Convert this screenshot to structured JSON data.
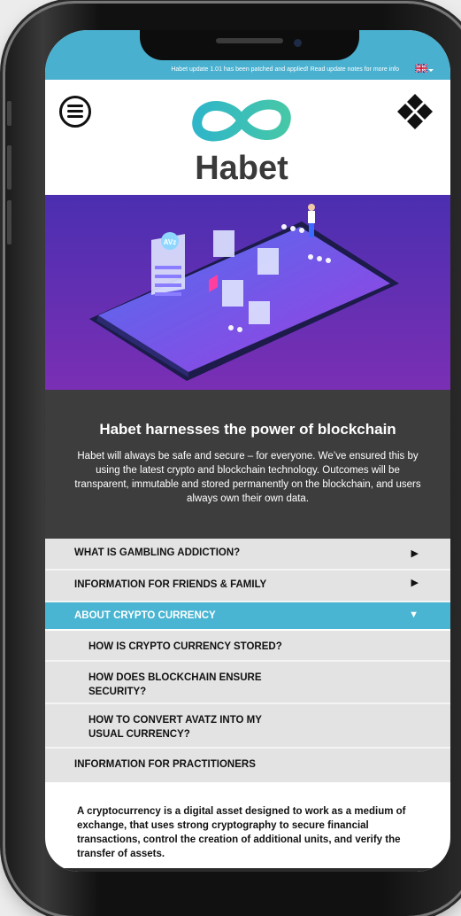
{
  "banner": {
    "update_text": "Habet update 1.01 has been patched and applied! Read update notes for more info",
    "language_flag": "uk-flag-icon"
  },
  "header": {
    "logo_text": "Habet",
    "menu_icon": "hamburger-menu-icon",
    "grid_icon": "diamond-grid-icon"
  },
  "hero": {
    "coin_label": "AVz"
  },
  "info": {
    "title": "Habet harnesses the power of blockchain",
    "body": "Habet will always be safe and secure – for everyone. We’ve ensured this by using the latest crypto and blockchain technology. Outcomes will be transparent, immutable and stored permanently on the blockchain, and users always own their own data."
  },
  "accordion": [
    {
      "label": "WHAT IS GAMBLING ADDICTION?",
      "arrow": "▶",
      "state": "collapsed"
    },
    {
      "label": "INFORMATION FOR FRIENDS & FAMILY",
      "arrow": "▶",
      "state": "collapsed"
    },
    {
      "label": "ABOUT CRYPTO CURRENCY",
      "arrow": "▼",
      "state": "expanded"
    }
  ],
  "sub_items": [
    {
      "label": "HOW IS CRYPTO CURRENCY STORED?"
    },
    {
      "label": "HOW DOES BLOCKCHAIN ENSURE SECURITY?"
    },
    {
      "label": "HOW TO CONVERT  AVATZ INTO MY USUAL CURRENCY?"
    }
  ],
  "practitioners": {
    "label": "INFORMATION FOR PRACTITIONERS"
  },
  "content": {
    "text": "A cryptocurrency is a digital asset designed to work as a medium of exchange, that uses strong cryptography to secure financial transactions, control the creation of additional units, and verify the transfer of assets."
  },
  "colors": {
    "accent": "#4ab5d3",
    "banner": "#4ab0cf",
    "dark_panel": "#3d3d3d",
    "accordion_grey": "#e3e3e3"
  }
}
